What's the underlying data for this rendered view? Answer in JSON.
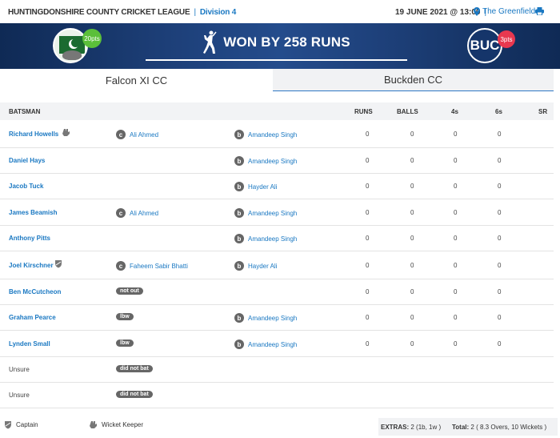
{
  "header": {
    "league": "HUNTINGDONSHIRE COUNTY CRICKET LEAGUE",
    "separator": "|",
    "division": "Division 4",
    "date_time": "19 JUNE 2021 @ 13:00",
    "separator2": "|",
    "venue": "The Greenfields"
  },
  "banner": {
    "home_points": "20pts",
    "result": "WON BY 258 RUNS",
    "away_abbr": "BUC",
    "away_points": "3pts"
  },
  "tabs": [
    {
      "label": "Falcon XI CC"
    },
    {
      "label": "Buckden CC"
    }
  ],
  "table": {
    "headers": {
      "batsman": "BATSMAN",
      "runs": "RUNS",
      "balls": "BALLS",
      "fours": "4s",
      "sixes": "6s",
      "sr": "SR"
    },
    "rows": [
      {
        "name": "Richard Howells",
        "keeper": true,
        "captain": false,
        "linked": true,
        "dismissal_type": "c",
        "dismissal_label": "",
        "fielder": "Ali Ahmed",
        "bowler_type": "b",
        "bowler": "Amandeep Singh",
        "runs": "0",
        "balls": "0",
        "fours": "0",
        "sixes": "0",
        "sr": ""
      },
      {
        "name": "Daniel Hays",
        "keeper": false,
        "captain": false,
        "linked": true,
        "dismissal_type": "",
        "dismissal_label": "",
        "fielder": "",
        "bowler_type": "b",
        "bowler": "Amandeep Singh",
        "runs": "0",
        "balls": "0",
        "fours": "0",
        "sixes": "0",
        "sr": ""
      },
      {
        "name": "Jacob Tuck",
        "keeper": false,
        "captain": false,
        "linked": true,
        "dismissal_type": "",
        "dismissal_label": "",
        "fielder": "",
        "bowler_type": "b",
        "bowler": "Hayder Ali",
        "runs": "0",
        "balls": "0",
        "fours": "0",
        "sixes": "0",
        "sr": ""
      },
      {
        "name": "James Beamish",
        "keeper": false,
        "captain": false,
        "linked": true,
        "dismissal_type": "c",
        "dismissal_label": "",
        "fielder": "Ali Ahmed",
        "bowler_type": "b",
        "bowler": "Amandeep Singh",
        "runs": "0",
        "balls": "0",
        "fours": "0",
        "sixes": "0",
        "sr": ""
      },
      {
        "name": "Anthony Pitts",
        "keeper": false,
        "captain": false,
        "linked": true,
        "dismissal_type": "",
        "dismissal_label": "",
        "fielder": "",
        "bowler_type": "b",
        "bowler": "Amandeep Singh",
        "runs": "0",
        "balls": "0",
        "fours": "0",
        "sixes": "0",
        "sr": ""
      },
      {
        "name": "Joel Kirschner",
        "keeper": false,
        "captain": true,
        "linked": true,
        "dismissal_type": "c",
        "dismissal_label": "",
        "fielder": "Faheem Sabir Bhatti",
        "bowler_type": "b",
        "bowler": "Hayder Ali",
        "runs": "0",
        "balls": "0",
        "fours": "0",
        "sixes": "0",
        "sr": ""
      },
      {
        "name": "Ben McCutcheon",
        "keeper": false,
        "captain": false,
        "linked": true,
        "dismissal_type": "",
        "dismissal_label": "not out",
        "fielder": "",
        "bowler_type": "",
        "bowler": "",
        "runs": "0",
        "balls": "0",
        "fours": "0",
        "sixes": "0",
        "sr": ""
      },
      {
        "name": "Graham Pearce",
        "keeper": false,
        "captain": false,
        "linked": true,
        "dismissal_type": "",
        "dismissal_label": "lbw",
        "fielder": "",
        "bowler_type": "b",
        "bowler": "Amandeep Singh",
        "runs": "0",
        "balls": "0",
        "fours": "0",
        "sixes": "0",
        "sr": ""
      },
      {
        "name": "Lynden Small",
        "keeper": false,
        "captain": false,
        "linked": true,
        "dismissal_type": "",
        "dismissal_label": "lbw",
        "fielder": "",
        "bowler_type": "b",
        "bowler": "Amandeep Singh",
        "runs": "0",
        "balls": "0",
        "fours": "0",
        "sixes": "0",
        "sr": ""
      },
      {
        "name": "Unsure",
        "keeper": false,
        "captain": false,
        "linked": false,
        "dismissal_type": "",
        "dismissal_label": "did not bat",
        "fielder": "",
        "bowler_type": "",
        "bowler": "",
        "runs": "",
        "balls": "",
        "fours": "",
        "sixes": "",
        "sr": ""
      },
      {
        "name": "Unsure",
        "keeper": false,
        "captain": false,
        "linked": false,
        "dismissal_type": "",
        "dismissal_label": "did not bat",
        "fielder": "",
        "bowler_type": "",
        "bowler": "",
        "runs": "",
        "balls": "",
        "fours": "",
        "sixes": "",
        "sr": ""
      }
    ]
  },
  "footer": {
    "captain_label": "Captain",
    "keeper_label": "Wicket Keeper",
    "extras_label": "EXTRAS:",
    "extras_value": "2 (1b, 1w )",
    "total_label": "Total:",
    "total_value": "2 ( 8.3 Overs, 10 Wickets )"
  },
  "colors": {
    "link": "#1a78c2",
    "banner": "#1d3f78",
    "home_points": "#5bbf3a",
    "away_points": "#e8384f"
  },
  "icons": {
    "venue": "map-pin-icon",
    "print": "printer-icon",
    "captain": "shield-icon",
    "keeper": "gloves-icon",
    "result": "bowler-icon"
  }
}
